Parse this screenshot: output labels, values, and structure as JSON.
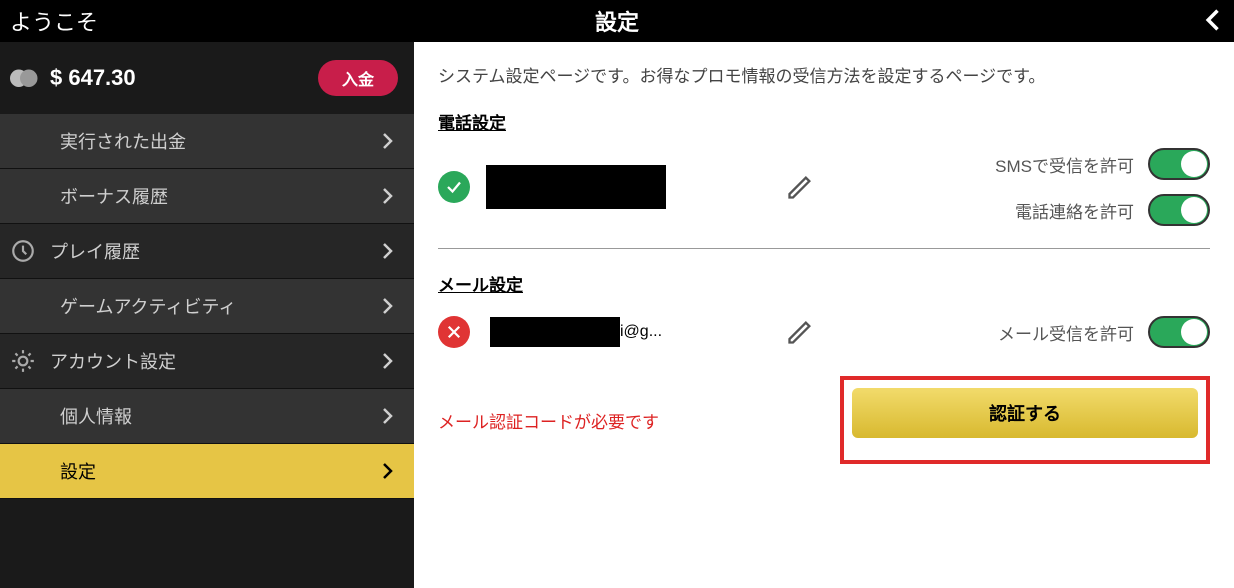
{
  "header": {
    "welcome": "ようこそ",
    "title": "設定"
  },
  "sidebar": {
    "balance": "$ 647.30",
    "deposit_label": "入金",
    "items": [
      {
        "label": "実行された出金",
        "type": "sub"
      },
      {
        "label": "ボーナス履歴",
        "type": "sub"
      },
      {
        "label": "プレイ履歴",
        "type": "top",
        "icon": "clock"
      },
      {
        "label": "ゲームアクティビティ",
        "type": "sub"
      },
      {
        "label": "アカウント設定",
        "type": "top",
        "icon": "gear"
      },
      {
        "label": "個人情報",
        "type": "sub"
      },
      {
        "label": "設定",
        "type": "sub",
        "active": true
      }
    ]
  },
  "content": {
    "description": "システム設定ページです。お得なプロモ情報の受信方法を設定するページです。",
    "phone": {
      "title": "電話設定",
      "value_masked": "",
      "sms_label": "SMSで受信を許可",
      "call_label": "電話連絡を許可"
    },
    "email": {
      "title": "メール設定",
      "value_suffix": "i@g...",
      "receive_label": "メール受信を許可",
      "need_verify": "メール認証コードが必要です",
      "verify_btn": "認証する"
    }
  }
}
